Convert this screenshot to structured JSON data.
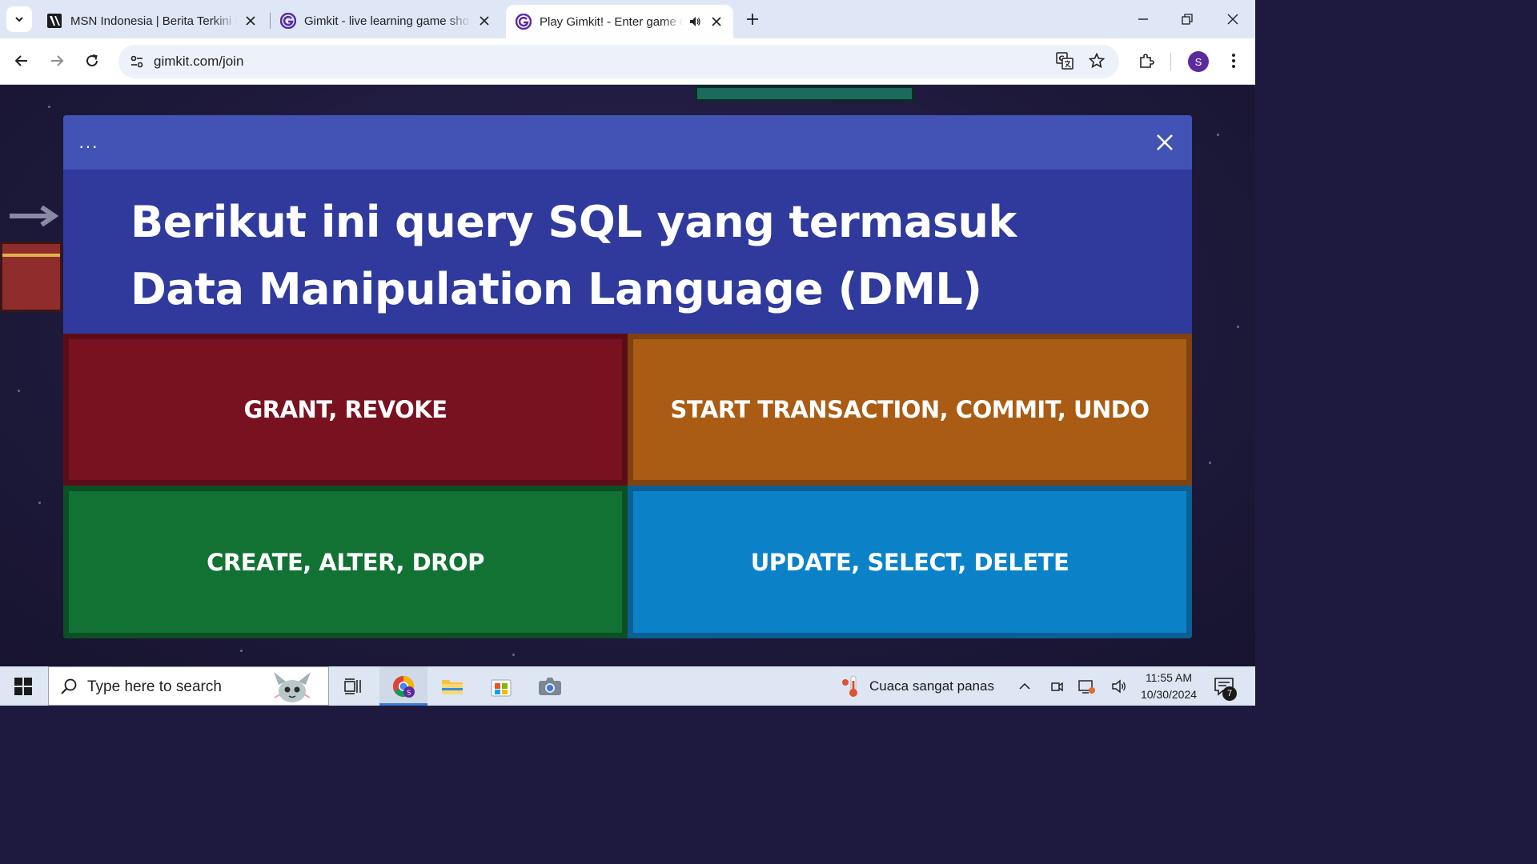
{
  "browser": {
    "tabs": [
      {
        "title": "MSN Indonesia | Berita Terkini H",
        "favicon": "msn-favicon",
        "active": false
      },
      {
        "title": "Gimkit - live learning game sho",
        "favicon": "gimkit-favicon",
        "active": false
      },
      {
        "title": "Play Gimkit! - Enter game c",
        "favicon": "gimkit-favicon",
        "active": true,
        "audio": true
      }
    ],
    "url": "gimkit.com/join",
    "profile_initial": "S",
    "accent": "#5b2a9e"
  },
  "game": {
    "menu_label": "...",
    "question": "Berikut ini query SQL yang termasuk Data Manipulation Language (DML) adalah ...",
    "answers": [
      {
        "label": "GRANT, REVOKE",
        "color": "#781220"
      },
      {
        "label": "START TRANSACTION, COMMIT, UNDO",
        "color": "#aa5c14"
      },
      {
        "label": "CREATE, ALTER, DROP",
        "color": "#127234"
      },
      {
        "label": "UPDATE, SELECT, DELETE",
        "color": "#0b82c8"
      }
    ]
  },
  "taskbar": {
    "search_placeholder": "Type here to search",
    "weather_text": "Cuaca sangat panas",
    "time": "11:55 AM",
    "date": "10/30/2024",
    "notification_count": "7"
  }
}
